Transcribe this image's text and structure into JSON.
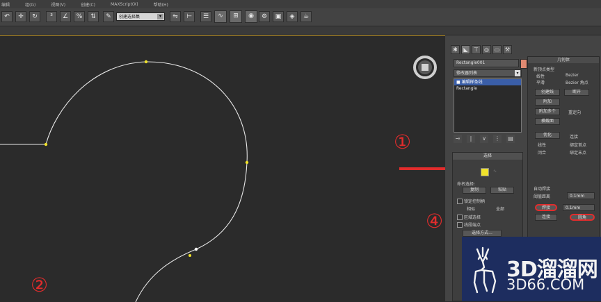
{
  "menubar": {
    "items": [
      "编辑",
      "组(G)",
      "视图(V)",
      "创建(C)",
      "MAXScript(X)",
      "帮助(H)"
    ]
  },
  "toolbar": {
    "icons": [
      "arrow-icon",
      "move-icon",
      "link-icon",
      "unlink-icon",
      "bind-icon",
      "select-icon",
      "mirror-icon",
      "align-icon",
      "layer-icon",
      "curve-editor-icon",
      "schematic-icon",
      "material-editor-icon",
      "render-setup-icon",
      "render-frame-icon",
      "render-icon",
      "teapot-icon"
    ],
    "selection_set": "创建选择集"
  },
  "command_panel": {
    "tabs": [
      "create-icon",
      "modify-icon",
      "hierarchy-icon",
      "motion-icon",
      "display-icon",
      "utilities-icon"
    ],
    "object_name": "Rectangle001",
    "object_color": "#e08a72",
    "modifier_list": "修改器列表",
    "stack": [
      {
        "label": "■ 编辑样条线",
        "selected": true
      },
      {
        "label": "Rectangle",
        "selected": false
      }
    ],
    "stack_buttons": [
      "pin-icon",
      "show-end-icon",
      "make-unique-icon",
      "remove-icon",
      "configure-icon"
    ],
    "selection_rollout": {
      "title": "选择",
      "named_selections": "命名选择:",
      "copy_label": "复制",
      "paste_label": "粘贴",
      "lock_handles": "锁定控制柄",
      "similar": "相似",
      "all": "全部",
      "area_select": "区域选择",
      "segment_end": "线段端点",
      "select_by": "选择方式..."
    },
    "geometry_rollout": {
      "title": "几何体",
      "new_vertex_type": "新顶点类型",
      "linear": "线性",
      "smooth": "平滑",
      "bezier": "Bezier",
      "bezier_corner": "Bezier 角点",
      "create_line": "创建线",
      "break": "断开",
      "attach": "附加",
      "attach_mult": "附加多个",
      "reorient": "重定向",
      "cross_section": "横截面",
      "optimize": "优化",
      "connect": "连接",
      "linear2": "线性",
      "closed": "闭合",
      "bind_first": "绑定首点",
      "bind_last": "绑定末点",
      "auto_weld": "自动焊接",
      "threshold_label": "阈值距离",
      "threshold_value": "0.1mm",
      "weld": "焊接",
      "weld_value": "0.1mm",
      "fillet": "圆角"
    }
  },
  "annotations": [
    "①",
    "②",
    "④"
  ],
  "watermark": {
    "main": "3D溜溜网",
    "sub": "3D66.COM"
  },
  "colors": {
    "annotation": "#e22c2c",
    "vertex": "#f0e22a",
    "watermark_bg": "#1d2d5f"
  }
}
